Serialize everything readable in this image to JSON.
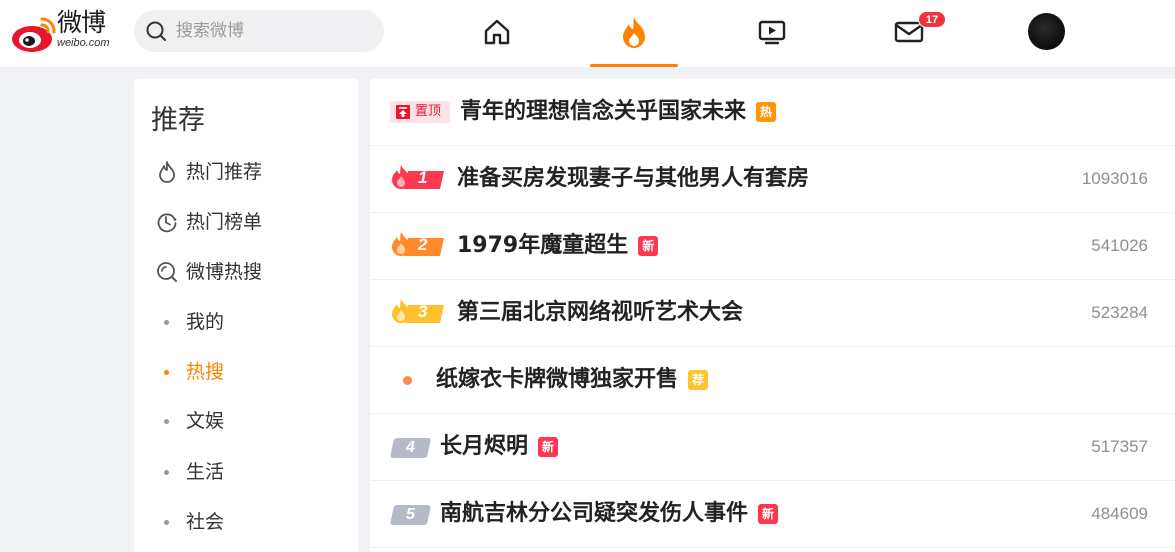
{
  "header": {
    "logo_text": "微博",
    "logo_sub": "weibo.com",
    "search_placeholder": "搜索微博",
    "messages_badge": "17",
    "nav_icons": [
      "home-icon",
      "hot-flame-icon",
      "video-icon",
      "mail-icon"
    ],
    "active_nav": "hot-flame-icon",
    "accent_color": "#ff8200"
  },
  "sidebar": {
    "title": "推荐",
    "items": [
      {
        "label": "热门推荐",
        "icon": "flame-outline-icon",
        "active": false
      },
      {
        "label": "热门榜单",
        "icon": "clock-ranking-icon",
        "active": false
      },
      {
        "label": "微博热搜",
        "icon": "search-hot-icon",
        "active": false
      },
      {
        "label": "我的",
        "icon": "dot",
        "active": false
      },
      {
        "label": "热搜",
        "icon": "dot",
        "active": true
      },
      {
        "label": "文娱",
        "icon": "dot",
        "active": false
      },
      {
        "label": "生活",
        "icon": "dot",
        "active": false
      },
      {
        "label": "社会",
        "icon": "dot",
        "active": false
      }
    ]
  },
  "hot_list": {
    "pinned": {
      "pin_label": "置顶",
      "title": "青年的理想信念关乎国家未来",
      "tag": "热"
    },
    "items": [
      {
        "rank": "1",
        "title": "准备买房发现妻子与其他男人有套房",
        "tag": "",
        "count": "1093016"
      },
      {
        "rank": "2",
        "title": "1979年魔童超生",
        "tag": "新",
        "count": "541026"
      },
      {
        "rank": "3",
        "title": "第三届北京网络视听艺术大会",
        "tag": "",
        "count": "523284"
      },
      {
        "rank": "",
        "title": "纸嫁衣卡牌微博独家开售",
        "tag": "荐",
        "count": ""
      },
      {
        "rank": "4",
        "title": "长月烬明",
        "tag": "新",
        "count": "517357"
      },
      {
        "rank": "5",
        "title": "南航吉林分公司疑突发伤人事件",
        "tag": "新",
        "count": "484609"
      }
    ]
  }
}
